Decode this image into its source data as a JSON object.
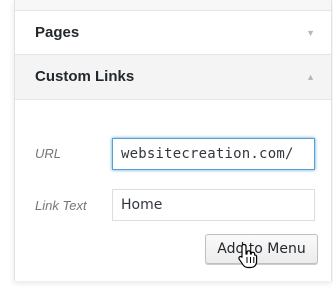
{
  "accordion": {
    "pages": {
      "title": "Pages",
      "arrow": "▼"
    },
    "custom_links": {
      "title": "Custom Links",
      "arrow": "▲",
      "url": {
        "label": "URL",
        "value": "websitecreation.com/"
      },
      "link_text": {
        "label": "Link Text",
        "value": "Home"
      },
      "add_button": {
        "label": "Add to Menu"
      }
    }
  },
  "icons": {
    "pages_toggle": "chevron-down-icon",
    "custom_toggle": "chevron-up-icon",
    "cursor": "hand-pointer-icon"
  },
  "colors": {
    "focus_border": "#5b9dd9",
    "text": "#23282d",
    "label": "#72777c"
  }
}
